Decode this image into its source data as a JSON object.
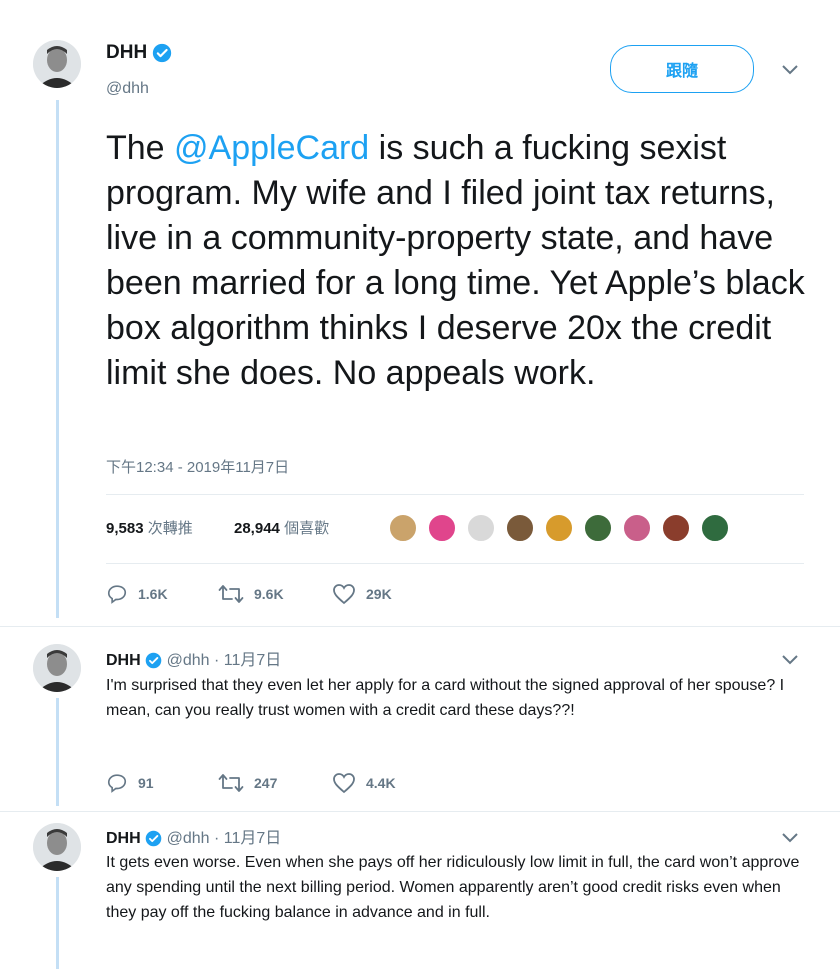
{
  "main_tweet": {
    "author_name": "DHH",
    "author_handle": "@dhh",
    "follow_label": "跟隨",
    "text_before": "The ",
    "mention": "@AppleCard",
    "text_after": " is such a fucking sexist program. My wife and I filed joint tax returns, live in a community-property state, and have been married for a long time. Yet Apple’s black box algorithm thinks I deserve 20x the credit limit she does. No appeals work.",
    "timestamp": "下午12:34 - 2019年11月7日",
    "retweets_value": "9,583",
    "retweets_label": "次轉推",
    "likes_value": "28,944",
    "likes_label": "個喜歡",
    "liker_colors": [
      "#caa36b",
      "#e0458c",
      "#d9d9d9",
      "#7a5a3a",
      "#d79b2c",
      "#3d6b3a",
      "#c95f8a",
      "#8a3d2c",
      "#2f6b3f"
    ],
    "replies": "1.6K",
    "retweets_short": "9.6K",
    "likes_short": "29K"
  },
  "replies": [
    {
      "author_name": "DHH",
      "author_handle": "@dhh",
      "date": "· 11月7日",
      "text": "I'm surprised that they even let her apply for a card without the signed approval of her spouse? I mean, can you really trust women with a credit card these days??!",
      "replies": "91",
      "retweets": "247",
      "likes": "4.4K"
    },
    {
      "author_name": "DHH",
      "author_handle": "@dhh",
      "date": "· 11月7日",
      "text": "It gets even worse. Even when she pays off her ridiculously low limit in full, the card won’t approve any spending until the next billing period. Women apparently aren’t good credit risks even when they pay off the fucking balance in advance and in full."
    }
  ],
  "colors": {
    "accent": "#1da1f2",
    "secondary_text": "#657786",
    "thread_line": "#c4dff5"
  }
}
